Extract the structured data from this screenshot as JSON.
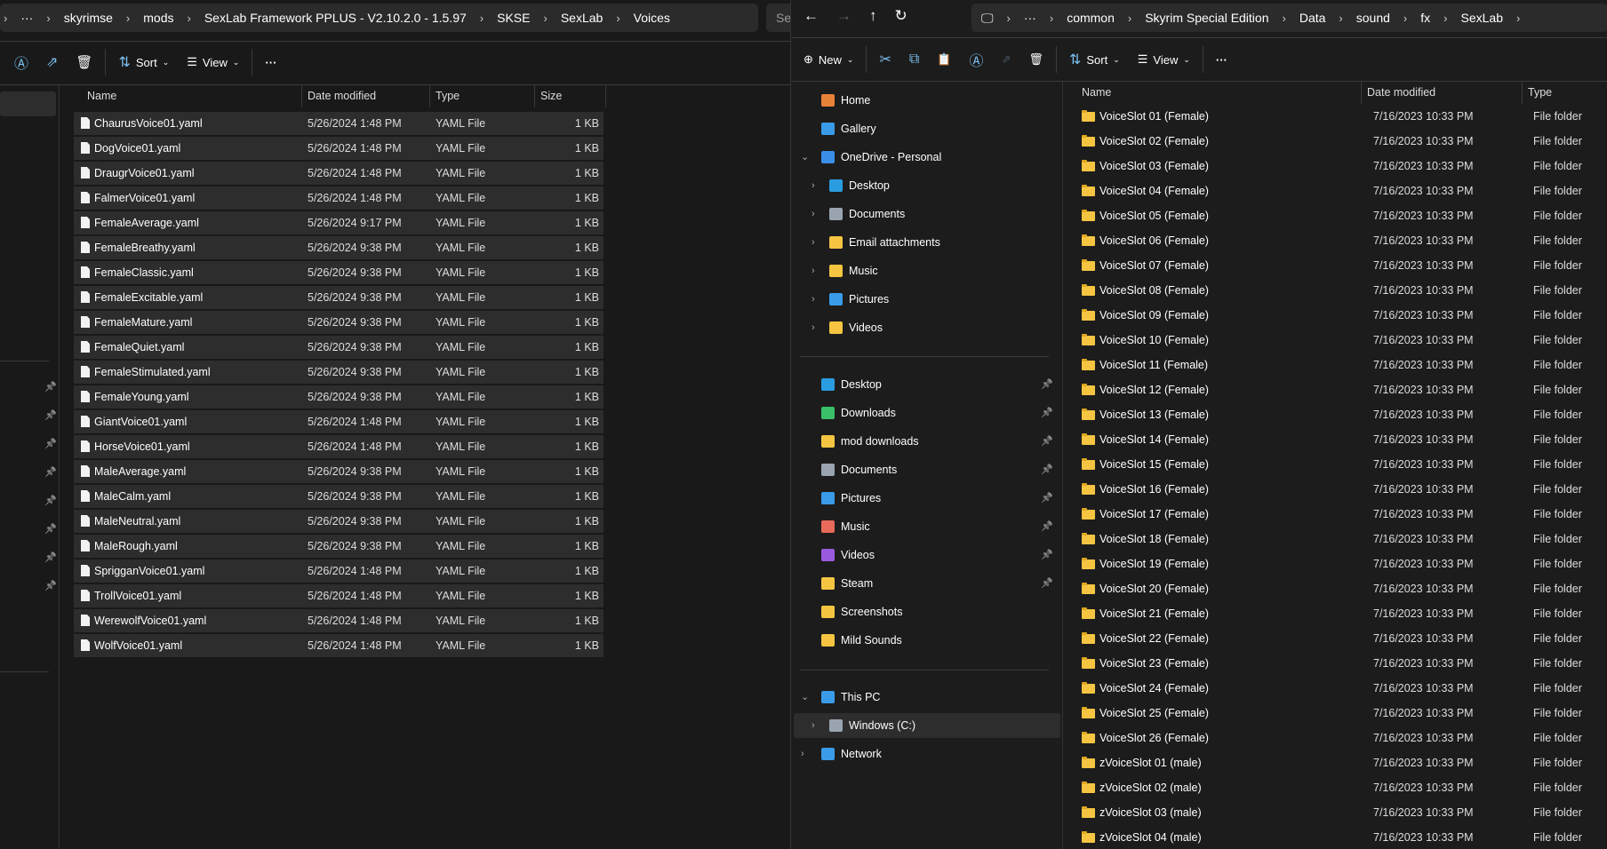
{
  "left": {
    "breadcrumb": [
      "skyrimse",
      "mods",
      "SexLab Framework PPLUS - V2.10.2.0 - 1.5.97",
      "SKSE",
      "SexLab",
      "Voices"
    ],
    "search_placeholder": "Se",
    "toolbar": {
      "sort": "Sort",
      "view": "View",
      "more": "···"
    },
    "columns": [
      "Name",
      "Date modified",
      "Type",
      "Size"
    ],
    "files": [
      [
        "ChaurusVoice01.yaml",
        "5/26/2024 1:48 PM"
      ],
      [
        "DogVoice01.yaml",
        "5/26/2024 1:48 PM"
      ],
      [
        "DraugrVoice01.yaml",
        "5/26/2024 1:48 PM"
      ],
      [
        "FalmerVoice01.yaml",
        "5/26/2024 1:48 PM"
      ],
      [
        "FemaleAverage.yaml",
        "5/26/2024 9:17 PM"
      ],
      [
        "FemaleBreathy.yaml",
        "5/26/2024 9:38 PM"
      ],
      [
        "FemaleClassic.yaml",
        "5/26/2024 9:38 PM"
      ],
      [
        "FemaleExcitable.yaml",
        "5/26/2024 9:38 PM"
      ],
      [
        "FemaleMature.yaml",
        "5/26/2024 9:38 PM"
      ],
      [
        "FemaleQuiet.yaml",
        "5/26/2024 9:38 PM"
      ],
      [
        "FemaleStimulated.yaml",
        "5/26/2024 9:38 PM"
      ],
      [
        "FemaleYoung.yaml",
        "5/26/2024 9:38 PM"
      ],
      [
        "GiantVoice01.yaml",
        "5/26/2024 1:48 PM"
      ],
      [
        "HorseVoice01.yaml",
        "5/26/2024 1:48 PM"
      ],
      [
        "MaleAverage.yaml",
        "5/26/2024 9:38 PM"
      ],
      [
        "MaleCalm.yaml",
        "5/26/2024 9:38 PM"
      ],
      [
        "MaleNeutral.yaml",
        "5/26/2024 9:38 PM"
      ],
      [
        "MaleRough.yaml",
        "5/26/2024 9:38 PM"
      ],
      [
        "SprigganVoice01.yaml",
        "5/26/2024 1:48 PM"
      ],
      [
        "TrollVoice01.yaml",
        "5/26/2024 1:48 PM"
      ],
      [
        "WerewolfVoice01.yaml",
        "5/26/2024 1:48 PM"
      ],
      [
        "WolfVoice01.yaml",
        "5/26/2024 1:48 PM"
      ]
    ],
    "file_type": "YAML File",
    "file_size": "1 KB"
  },
  "right": {
    "breadcrumb": [
      "common",
      "Skyrim Special Edition",
      "Data",
      "sound",
      "fx",
      "SexLab"
    ],
    "toolbar": {
      "new": "New",
      "sort": "Sort",
      "view": "View",
      "more": "···"
    },
    "columns": [
      "Name",
      "Date modified",
      "Type"
    ],
    "nav": [
      {
        "label": "Home",
        "icon": "home-icon",
        "color": "#e8823a",
        "indent": 0,
        "chev": ""
      },
      {
        "label": "Gallery",
        "icon": "gallery-icon",
        "color": "#3a9be8",
        "indent": 0,
        "chev": ""
      },
      {
        "label": "OneDrive - Personal",
        "icon": "onedrive-icon",
        "color": "#3a8ee8",
        "indent": 0,
        "chev": "⌄"
      },
      {
        "label": "Desktop",
        "icon": "desktop-icon",
        "color": "#2a9de0",
        "indent": 1,
        "chev": "›"
      },
      {
        "label": "Documents",
        "icon": "documents-icon",
        "color": "#9aa4b0",
        "indent": 1,
        "chev": "›"
      },
      {
        "label": "Email attachments",
        "icon": "folder-icon",
        "color": "#f5c542",
        "indent": 1,
        "chev": "›"
      },
      {
        "label": "Music",
        "icon": "folder-icon",
        "color": "#f5c542",
        "indent": 1,
        "chev": "›"
      },
      {
        "label": "Pictures",
        "icon": "pictures-icon",
        "color": "#3a9be8",
        "indent": 1,
        "chev": "›"
      },
      {
        "label": "Videos",
        "icon": "folder-icon",
        "color": "#f5c542",
        "indent": 1,
        "chev": "›"
      },
      {
        "label": "Desktop",
        "icon": "desktop-icon",
        "color": "#2a9de0",
        "indent": 0,
        "chev": "",
        "pin": true
      },
      {
        "label": "Downloads",
        "icon": "downloads-icon",
        "color": "#3ac06a",
        "indent": 0,
        "chev": "",
        "pin": true
      },
      {
        "label": "mod downloads",
        "icon": "folder-icon",
        "color": "#f5c542",
        "indent": 0,
        "chev": "",
        "pin": true
      },
      {
        "label": "Documents",
        "icon": "documents-icon",
        "color": "#9aa4b0",
        "indent": 0,
        "chev": "",
        "pin": true
      },
      {
        "label": "Pictures",
        "icon": "pictures-icon",
        "color": "#3a9be8",
        "indent": 0,
        "chev": "",
        "pin": true
      },
      {
        "label": "Music",
        "icon": "music-icon",
        "color": "#e86a5a",
        "indent": 0,
        "chev": "",
        "pin": true
      },
      {
        "label": "Videos",
        "icon": "videos-icon",
        "color": "#9a5ae0",
        "indent": 0,
        "chev": "",
        "pin": true
      },
      {
        "label": "Steam",
        "icon": "folder-icon",
        "color": "#f5c542",
        "indent": 0,
        "chev": "",
        "pin": true
      },
      {
        "label": "Screenshots",
        "icon": "folder-icon",
        "color": "#f5c542",
        "indent": 0,
        "chev": ""
      },
      {
        "label": "Mild Sounds",
        "icon": "folder-icon",
        "color": "#f5c542",
        "indent": 0,
        "chev": ""
      },
      {
        "label": "This PC",
        "icon": "this-pc-icon",
        "color": "#3a9be8",
        "indent": 0,
        "chev": "⌄"
      },
      {
        "label": "Windows (C:)",
        "icon": "drive-icon",
        "color": "#9aa4b0",
        "indent": 1,
        "chev": "›",
        "selected": true
      },
      {
        "label": "Network",
        "icon": "network-icon",
        "color": "#3a9be8",
        "indent": 0,
        "chev": "›"
      }
    ],
    "folders": [
      "VoiceSlot 01 (Female)",
      "VoiceSlot 02 (Female)",
      "VoiceSlot 03 (Female)",
      "VoiceSlot 04 (Female)",
      "VoiceSlot 05 (Female)",
      "VoiceSlot 06 (Female)",
      "VoiceSlot 07 (Female)",
      "VoiceSlot 08 (Female)",
      "VoiceSlot 09 (Female)",
      "VoiceSlot 10 (Female)",
      "VoiceSlot 11 (Female)",
      "VoiceSlot 12 (Female)",
      "VoiceSlot 13 (Female)",
      "VoiceSlot 14 (Female)",
      "VoiceSlot 15 (Female)",
      "VoiceSlot 16 (Female)",
      "VoiceSlot 17 (Female)",
      "VoiceSlot 18 (Female)",
      "VoiceSlot 19 (Female)",
      "VoiceSlot 20 (Female)",
      "VoiceSlot 21 (Female)",
      "VoiceSlot 22 (Female)",
      "VoiceSlot 23 (Female)",
      "VoiceSlot 24 (Female)",
      "VoiceSlot 25 (Female)",
      "VoiceSlot 26 (Female)",
      "zVoiceSlot 01 (male)",
      "zVoiceSlot 02 (male)",
      "zVoiceSlot 03 (male)",
      "zVoiceSlot 04 (male)"
    ],
    "folder_date": "7/16/2023 10:33 PM",
    "folder_type": "File folder"
  }
}
